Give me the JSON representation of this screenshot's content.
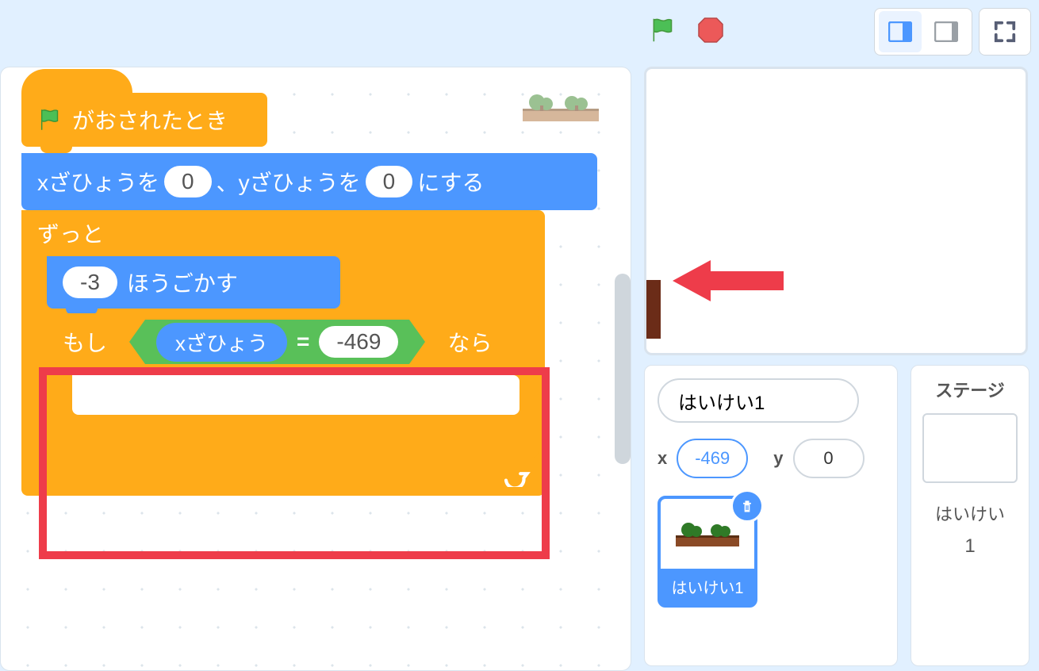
{
  "topbar": {
    "flag_icon": "green-flag",
    "stop_icon": "stop-sign",
    "view_small": "small-stage",
    "view_large": "large-stage",
    "view_full": "fullscreen"
  },
  "code": {
    "hat": {
      "label": "がおされたとき"
    },
    "goto": {
      "prefix": "xざひょうを",
      "x": "0",
      "mid": "、yざひょうを",
      "y": "0",
      "suffix": "にする"
    },
    "forever": {
      "label": "ずっと"
    },
    "move": {
      "steps": "-3",
      "label": "ほうごかす"
    },
    "if": {
      "prefix": "もし",
      "reporter": "xざひょう",
      "op": "=",
      "value": "-469",
      "suffix": "なら"
    }
  },
  "stage_arrow": "annotation-arrow",
  "sprite_info": {
    "name": "はいけい1",
    "x_label": "x",
    "x": "-469",
    "y_label": "y",
    "y": "0",
    "tile_label": "はいけい1"
  },
  "stage_panel": {
    "title": "ステージ",
    "label": "はいけい",
    "count": "1"
  }
}
